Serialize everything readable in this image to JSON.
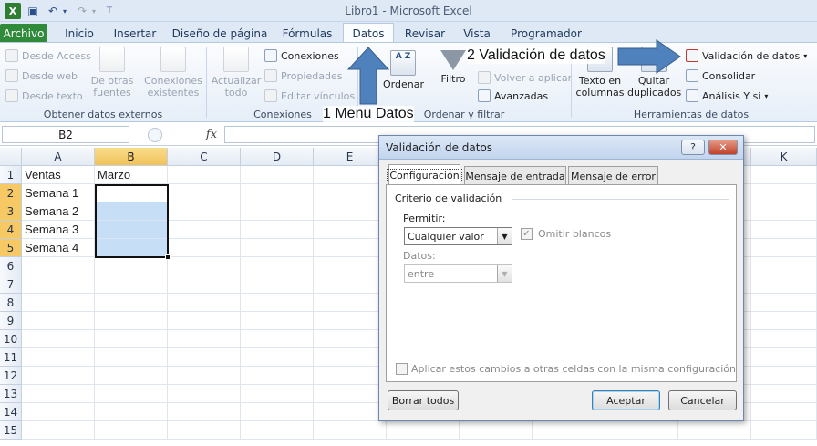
{
  "window": {
    "title": "Libro1  -  Microsoft Excel"
  },
  "quick_access": {
    "icons": [
      "save-icon",
      "undo-icon",
      "redo-icon",
      "customize-icon"
    ]
  },
  "tabs": [
    {
      "label": "Archivo"
    },
    {
      "label": "Inicio"
    },
    {
      "label": "Insertar"
    },
    {
      "label": "Diseño de página"
    },
    {
      "label": "Fórmulas"
    },
    {
      "label": "Datos"
    },
    {
      "label": "Revisar"
    },
    {
      "label": "Vista"
    },
    {
      "label": "Programador"
    }
  ],
  "ribbon": {
    "external": {
      "access": "Desde Access",
      "web": "Desde web",
      "text": "Desde texto",
      "other_1": "De otras",
      "other_2": "fuentes",
      "existing_1": "Conexiones",
      "existing_2": "existentes",
      "label": "Obtener datos externos"
    },
    "connections": {
      "refresh_1": "Actualizar",
      "refresh_2": "todo",
      "conn": "Conexiones",
      "props": "Propiedades",
      "links": "Editar vínculos",
      "label": "Conexiones"
    },
    "sort": {
      "order": "Ordenar",
      "filter": "Filtro",
      "reapply": "Volver a aplicar",
      "advanced": "Avanzadas",
      "label": "Ordenar y filtrar"
    },
    "tools": {
      "text_cols_1": "Texto en",
      "text_cols_2": "columnas",
      "dup_1": "Quitar",
      "dup_2": "duplicados",
      "validation": "Validación de datos",
      "consolidate": "Consolidar",
      "whatif": "Análisis Y si",
      "label": "Herramientas de datos"
    }
  },
  "annotations": {
    "step1": "1 Menu Datos",
    "step2": "2 Validación de datos",
    "arrow_color": "#4f81bd"
  },
  "formula_bar": {
    "name_box": "B2",
    "fx": "fx",
    "value": ""
  },
  "grid": {
    "columns": [
      "A",
      "B",
      "C",
      "D",
      "E",
      "K"
    ],
    "rows": [
      "1",
      "2",
      "3",
      "4",
      "5",
      "6",
      "7",
      "8",
      "9",
      "10",
      "11",
      "12",
      "13",
      "14",
      "15"
    ],
    "cells": {
      "A1": "Ventas",
      "B1": "Marzo",
      "A2": "Semana 1",
      "A3": "Semana 2",
      "A4": "Semana 3",
      "A5": "Semana 4"
    }
  },
  "dialog": {
    "title": "Validación de datos",
    "help": "?",
    "close": "✕",
    "tabs": [
      "Configuración",
      "Mensaje de entrada",
      "Mensaje de error"
    ],
    "section": "Criterio de validación",
    "allow_label": "Permitir:",
    "allow_value": "Cualquier valor",
    "ignore_blank": "Omitir blancos",
    "data_label": "Datos:",
    "data_value": "entre",
    "apply_all": "Aplicar estos cambios a otras celdas con la misma configuración",
    "clear": "Borrar todos",
    "ok": "Aceptar",
    "cancel": "Cancelar"
  }
}
